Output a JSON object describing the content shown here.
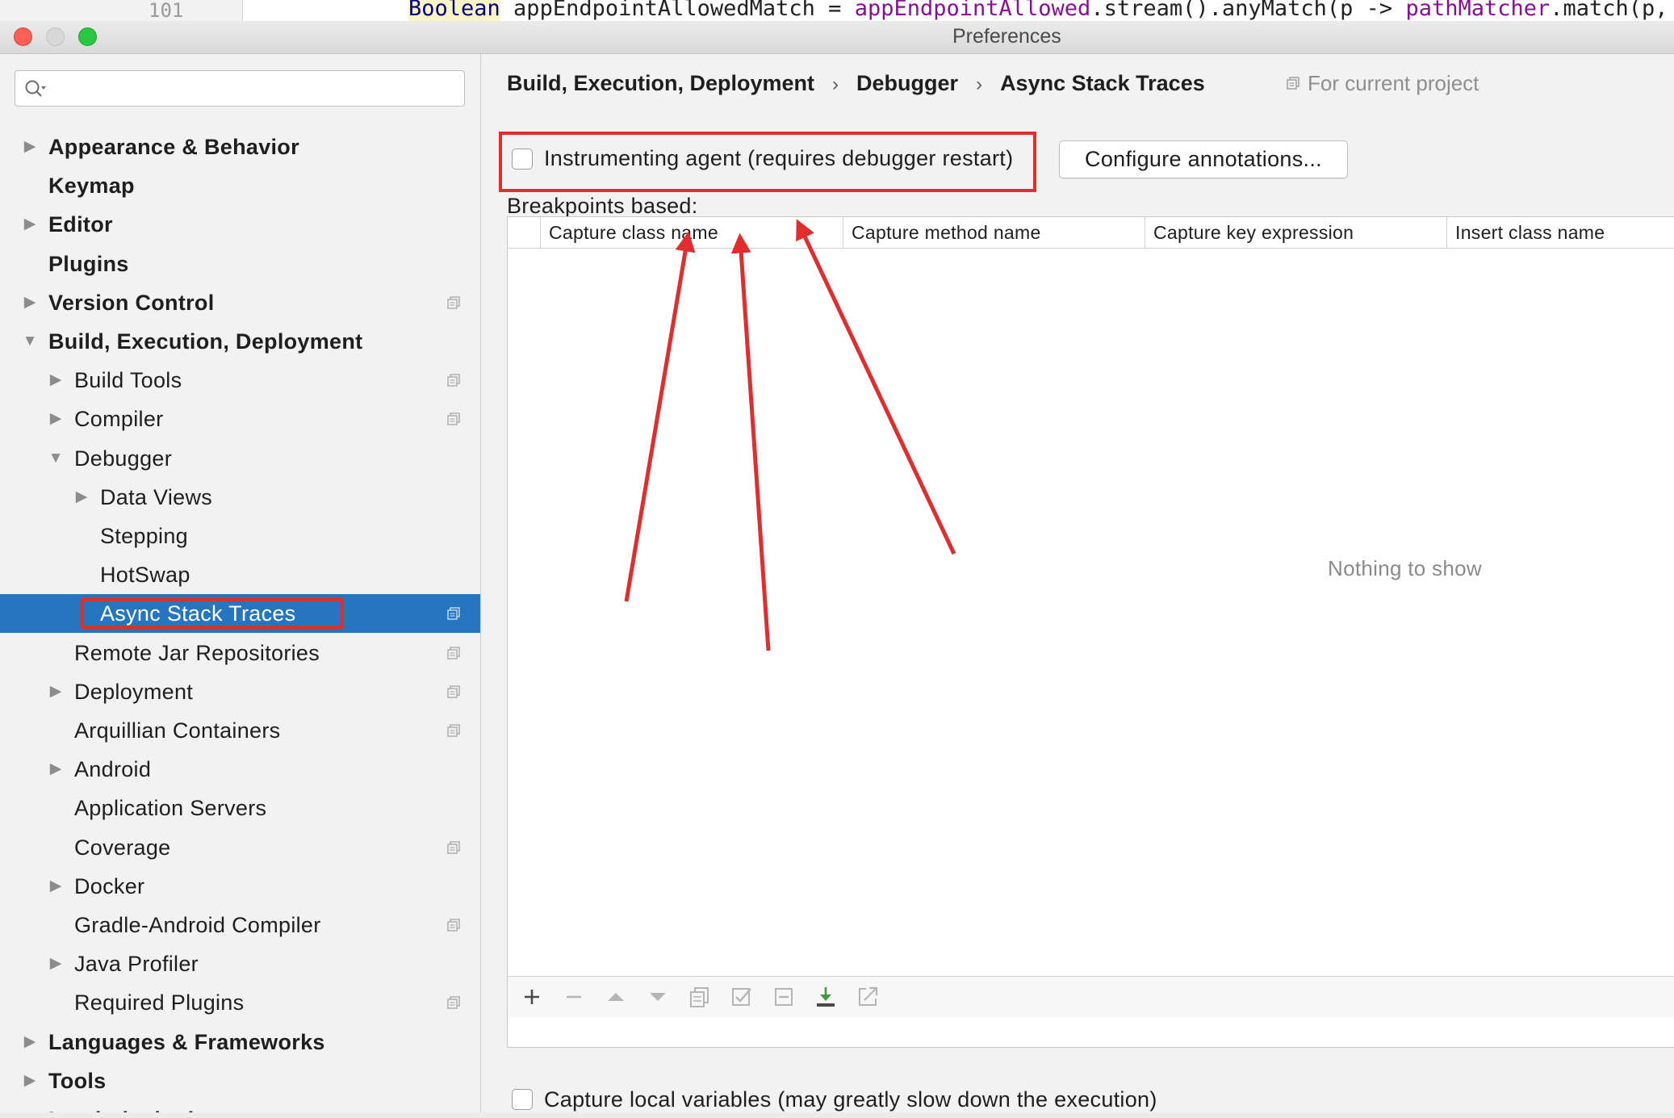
{
  "editor": {
    "line_number": "101",
    "code_parts": [
      {
        "text": "Boolean",
        "style": "kw"
      },
      {
        "text": " appEndpointAllowedMatch = ",
        "style": ""
      },
      {
        "text": "appEndpointAllowed",
        "style": "pu"
      },
      {
        "text": ".stream().anyMatch(p -> ",
        "style": ""
      },
      {
        "text": "pathMatcher",
        "style": "pu"
      },
      {
        "text": ".match(p, r",
        "style": ""
      }
    ]
  },
  "window": {
    "title": "Preferences"
  },
  "sidebar": {
    "search": {
      "value": "",
      "placeholder": ""
    },
    "items": [
      {
        "label": "Appearance & Behavior",
        "level": 0,
        "arrow": "right",
        "bold": true,
        "copy": false
      },
      {
        "label": "Keymap",
        "level": 0,
        "arrow": "",
        "bold": true,
        "copy": false
      },
      {
        "label": "Editor",
        "level": 0,
        "arrow": "right",
        "bold": true,
        "copy": false
      },
      {
        "label": "Plugins",
        "level": 0,
        "arrow": "",
        "bold": true,
        "copy": false
      },
      {
        "label": "Version Control",
        "level": 0,
        "arrow": "right",
        "bold": true,
        "copy": true
      },
      {
        "label": "Build, Execution, Deployment",
        "level": 0,
        "arrow": "down",
        "bold": true,
        "copy": false
      },
      {
        "label": "Build Tools",
        "level": 1,
        "arrow": "right",
        "bold": false,
        "copy": true
      },
      {
        "label": "Compiler",
        "level": 1,
        "arrow": "right",
        "bold": false,
        "copy": true
      },
      {
        "label": "Debugger",
        "level": 1,
        "arrow": "down",
        "bold": false,
        "copy": false
      },
      {
        "label": "Data Views",
        "level": 2,
        "arrow": "right",
        "bold": false,
        "copy": false
      },
      {
        "label": "Stepping",
        "level": 2,
        "arrow": "",
        "bold": false,
        "copy": false
      },
      {
        "label": "HotSwap",
        "level": 2,
        "arrow": "",
        "bold": false,
        "copy": false
      },
      {
        "label": "Async Stack Traces",
        "level": 2,
        "arrow": "",
        "bold": false,
        "copy": true,
        "selected": true
      },
      {
        "label": "Remote Jar Repositories",
        "level": 1,
        "arrow": "",
        "bold": false,
        "copy": true
      },
      {
        "label": "Deployment",
        "level": 1,
        "arrow": "right",
        "bold": false,
        "copy": true
      },
      {
        "label": "Arquillian Containers",
        "level": 1,
        "arrow": "",
        "bold": false,
        "copy": true
      },
      {
        "label": "Android",
        "level": 1,
        "arrow": "right",
        "bold": false,
        "copy": false
      },
      {
        "label": "Application Servers",
        "level": 1,
        "arrow": "",
        "bold": false,
        "copy": false
      },
      {
        "label": "Coverage",
        "level": 1,
        "arrow": "",
        "bold": false,
        "copy": true
      },
      {
        "label": "Docker",
        "level": 1,
        "arrow": "right",
        "bold": false,
        "copy": false
      },
      {
        "label": "Gradle-Android Compiler",
        "level": 1,
        "arrow": "",
        "bold": false,
        "copy": true
      },
      {
        "label": "Java Profiler",
        "level": 1,
        "arrow": "right",
        "bold": false,
        "copy": false
      },
      {
        "label": "Required Plugins",
        "level": 1,
        "arrow": "",
        "bold": false,
        "copy": true
      },
      {
        "label": "Languages & Frameworks",
        "level": 0,
        "arrow": "right",
        "bold": true,
        "copy": false
      },
      {
        "label": "Tools",
        "level": 0,
        "arrow": "right",
        "bold": true,
        "copy": false
      },
      {
        "label": "Lombok plugin",
        "level": 0,
        "arrow": "",
        "bold": true,
        "copy": true
      }
    ]
  },
  "main": {
    "breadcrumb": [
      "Build, Execution, Deployment",
      "Debugger",
      "Async Stack Traces"
    ],
    "breadcrumb_separator": "›",
    "for_current_project": "For current project",
    "instrumenting_agent": {
      "label": "Instrumenting agent (requires debugger restart)",
      "checked": false
    },
    "configure_button": "Configure annotations...",
    "breakpoints_label": "Breakpoints based:",
    "table": {
      "columns": [
        "Capture class name",
        "Capture method name",
        "Capture key expression",
        "Insert class name"
      ],
      "rows": [],
      "empty_text": "Nothing to show"
    },
    "toolbar": [
      "add-icon",
      "remove-icon",
      "move-up-icon",
      "move-down-icon",
      "copy-icon",
      "enable-icon",
      "disable-icon",
      "import-icon",
      "export-icon"
    ],
    "capture_locals": {
      "label": "Capture local variables (may greatly slow down the execution)",
      "checked": false
    }
  },
  "colors": {
    "selection": "#2675bf",
    "annotation_red": "#e12d2d",
    "traffic_close": "#fe5f57",
    "traffic_zoom": "#2ac840"
  }
}
